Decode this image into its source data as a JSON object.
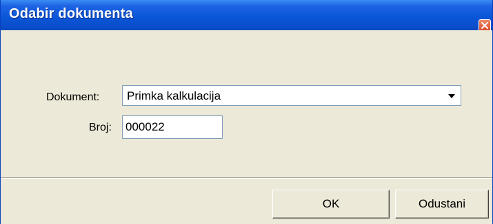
{
  "window": {
    "title": "Odabir dokumenta",
    "close_icon": "close-icon"
  },
  "form": {
    "document_label": "Dokument:",
    "document_value": "Primka kalkulacija",
    "dropdown_icon": "chevron-down-icon",
    "number_label": "Broj:",
    "number_value": "000022"
  },
  "buttons": {
    "ok_label": "OK",
    "cancel_label": "Odustani"
  },
  "colors": {
    "titlebar": "#0b56d8",
    "dialog_bg": "#ece9d8",
    "close_button": "#d8482a"
  }
}
